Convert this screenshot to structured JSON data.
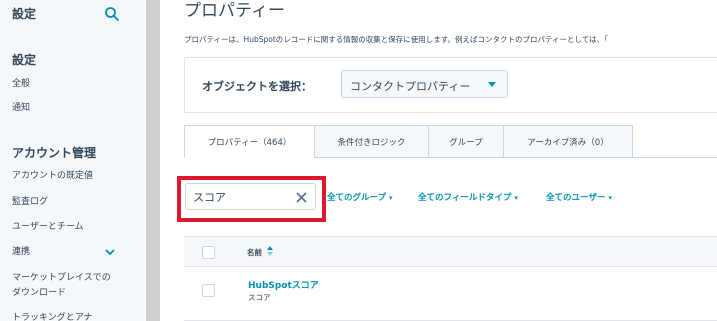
{
  "sidebar": {
    "title": "設定",
    "section_settings": "設定",
    "items_settings": [
      "全般",
      "通知"
    ],
    "section_account": "アカウント管理",
    "items_account": [
      "アカウントの既定値",
      "監査ログ",
      "ユーザーとチーム",
      "連携",
      "マーケットプレイスでの",
      "ダウンロード",
      "トラッキングとアナ"
    ]
  },
  "main": {
    "title": "プロパティー",
    "description": "プロパティーは、HubSpotのレコードに関する情報の収集と保存に使用します。例えばコンタクトのプロパティーとしては、「",
    "object_label": "オブジェクトを選択：",
    "object_selected": "コンタクトプロパティー",
    "tabs": [
      {
        "label": "プロパティー（464）"
      },
      {
        "label": "条件付きロジック"
      },
      {
        "label": "グループ"
      },
      {
        "label": "アーカイブ済み（0）"
      }
    ],
    "search_value": "スコア",
    "filters": [
      "全てのグループ",
      "全てのフィールドタイプ",
      "全てのユーザー"
    ],
    "table": {
      "column_name": "名前",
      "rows": [
        {
          "name": "HubSpotスコア",
          "group": "スコア"
        }
      ]
    }
  },
  "colors": {
    "accent": "#0091ae",
    "text": "#33475b",
    "highlight": "#e0182d",
    "sidebar_bg": "#f5f8fa"
  }
}
